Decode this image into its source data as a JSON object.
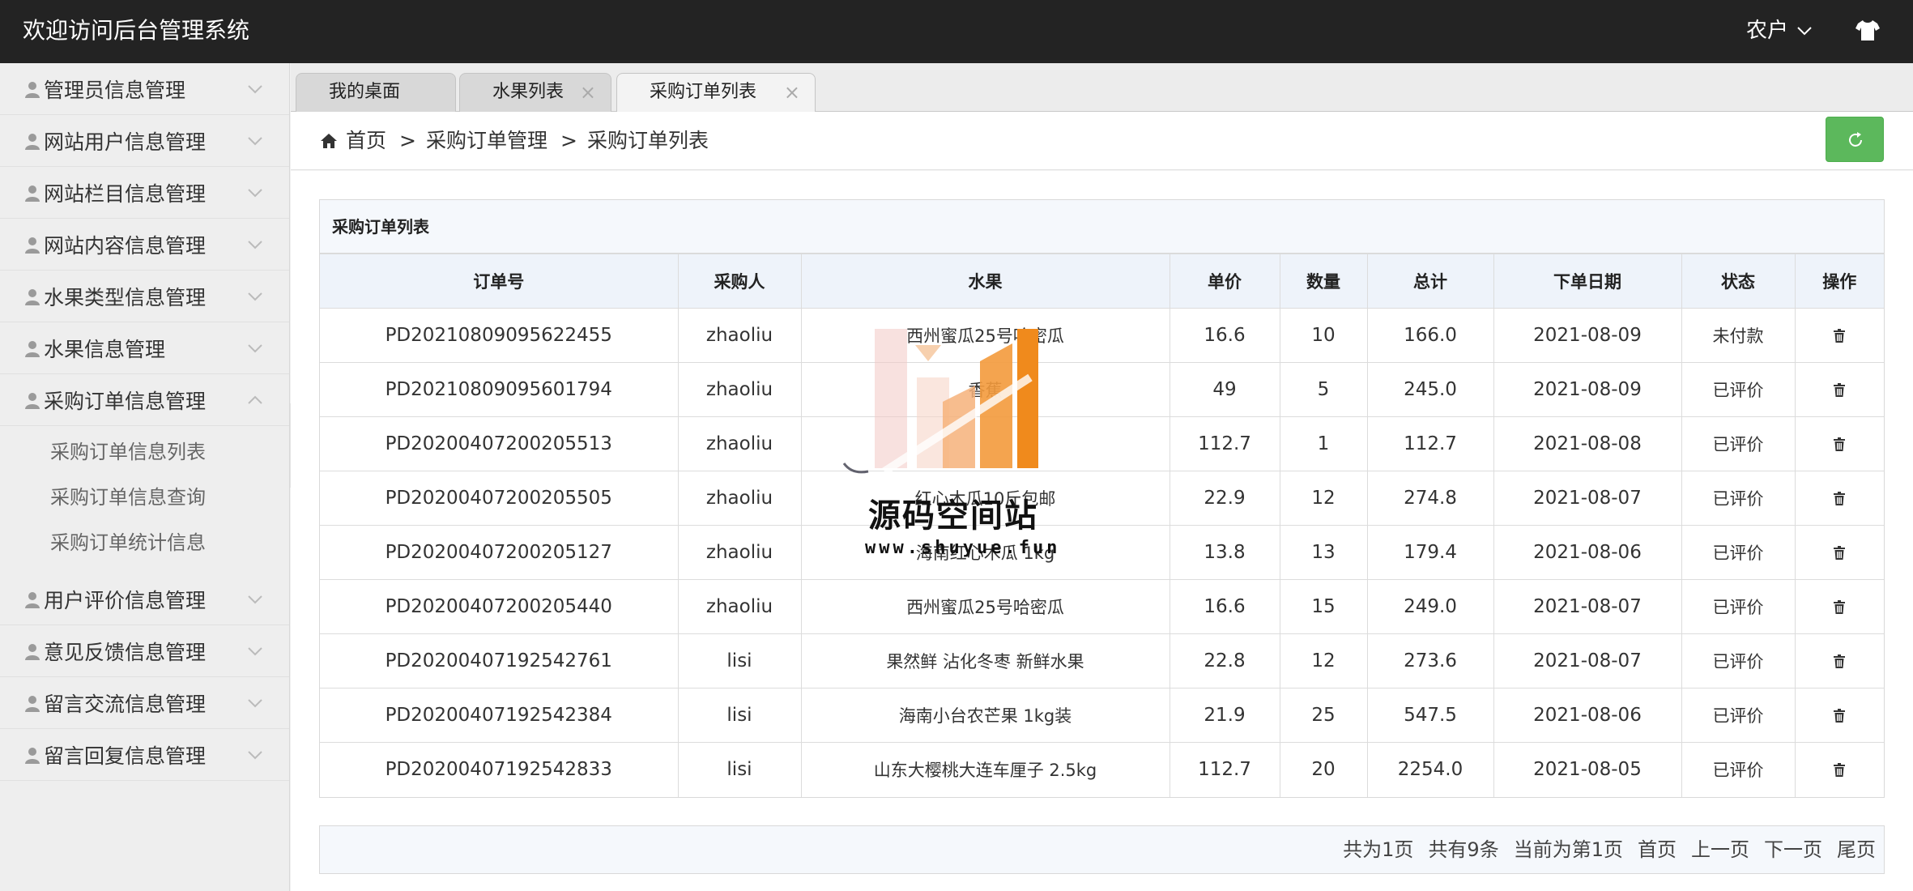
{
  "header": {
    "title": "欢迎访问后台管理系统",
    "user": "农户"
  },
  "sidebar": {
    "items": [
      {
        "label": "管理员信息管理"
      },
      {
        "label": "网站用户信息管理"
      },
      {
        "label": "网站栏目信息管理"
      },
      {
        "label": "网站内容信息管理"
      },
      {
        "label": "水果类型信息管理"
      },
      {
        "label": "水果信息管理"
      },
      {
        "label": "采购订单信息管理",
        "sub": [
          "采购订单信息列表",
          "采购订单信息查询",
          "采购订单统计信息"
        ]
      },
      {
        "label": "用户评价信息管理"
      },
      {
        "label": "意见反馈信息管理"
      },
      {
        "label": "留言交流信息管理"
      },
      {
        "label": "留言回复信息管理"
      }
    ]
  },
  "tabs": [
    {
      "label": "我的桌面"
    },
    {
      "label": "水果列表",
      "close": "×"
    },
    {
      "label": "采购订单列表",
      "close": "×"
    }
  ],
  "breadcrumb": {
    "home": "首页",
    "sep": ">",
    "level1": "采购订单管理",
    "level2": "采购订单列表"
  },
  "panel": {
    "title": "采购订单列表"
  },
  "table": {
    "headers": [
      "订单号",
      "采购人",
      "水果",
      "单价",
      "数量",
      "总计",
      "下单日期",
      "状态",
      "操作"
    ],
    "rows": [
      [
        "PD20210809095622455",
        "zhaoliu",
        "西州蜜瓜25号哈密瓜",
        "16.6",
        "10",
        "166.0",
        "2021-08-09",
        "未付款"
      ],
      [
        "PD20210809095601794",
        "zhaoliu",
        "香蕉",
        "49",
        "5",
        "245.0",
        "2021-08-09",
        "已评价"
      ],
      [
        "PD20200407200205513",
        "zhaoliu",
        "",
        "112.7",
        "1",
        "112.7",
        "2021-08-08",
        "已评价"
      ],
      [
        "PD20200407200205505",
        "zhaoliu",
        "红心木瓜10斤包邮",
        "22.9",
        "12",
        "274.8",
        "2021-08-07",
        "已评价"
      ],
      [
        "PD20200407200205127",
        "zhaoliu",
        "海南红心木瓜 1kg",
        "13.8",
        "13",
        "179.4",
        "2021-08-06",
        "已评价"
      ],
      [
        "PD20200407200205440",
        "zhaoliu",
        "西州蜜瓜25号哈密瓜",
        "16.6",
        "15",
        "249.0",
        "2021-08-07",
        "已评价"
      ],
      [
        "PD20200407192542761",
        "lisi",
        "果然鲜 沾化冬枣 新鲜水果",
        "22.8",
        "12",
        "273.6",
        "2021-08-07",
        "已评价"
      ],
      [
        "PD20200407192542384",
        "lisi",
        "海南小台农芒果 1kg装",
        "21.9",
        "25",
        "547.5",
        "2021-08-06",
        "已评价"
      ],
      [
        "PD20200407192542833",
        "lisi",
        "山东大樱桃大连车厘子 2.5kg",
        "112.7",
        "20",
        "2254.0",
        "2021-08-05",
        "已评价"
      ]
    ]
  },
  "pager": {
    "total_pages": "共为1页",
    "total_items": "共有9条",
    "current": "当前为第1页",
    "first": "首页",
    "prev": "上一页",
    "next": "下一页",
    "last": "尾页"
  },
  "watermark": {
    "title": "源码空间站",
    "url": "www.shuyue.fun"
  },
  "icons": {
    "user_menu": "chevron-down-icon",
    "theme": "tshirt-icon",
    "menu": "person-icon",
    "home": "home-icon",
    "refresh": "refresh-icon",
    "delete": "trash-icon"
  },
  "colors": {
    "header_bg": "#232323",
    "refresh_btn": "#5cb85c",
    "table_head_bg": "#eef3fa"
  }
}
